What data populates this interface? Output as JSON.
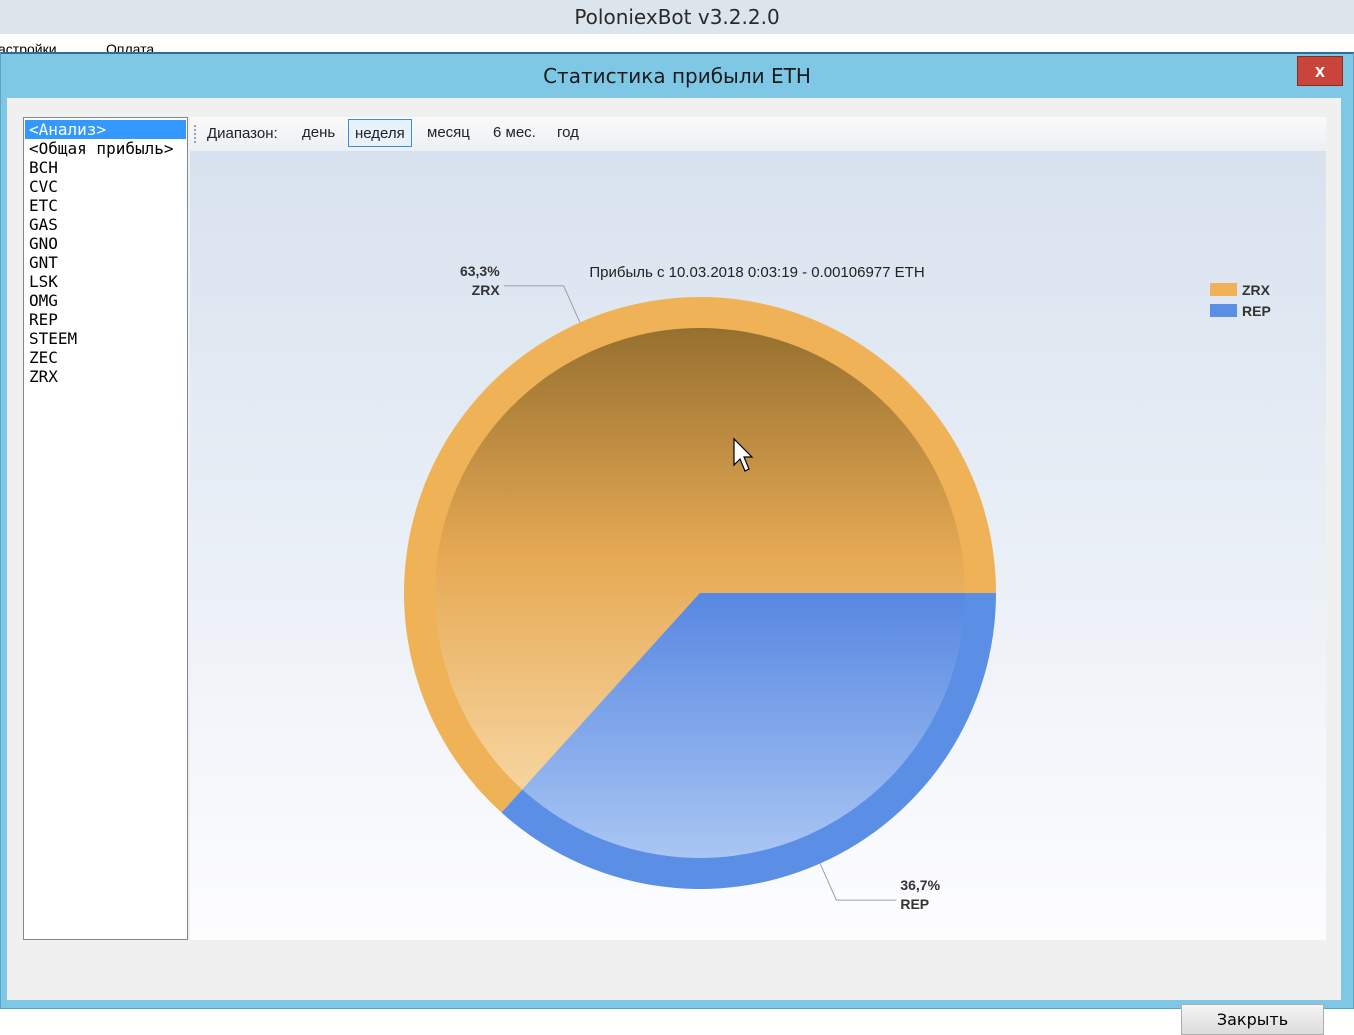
{
  "app": {
    "title": "PoloniexBot v3.2.2.0"
  },
  "main_menu": [
    "астройки",
    "Оплата"
  ],
  "dialog": {
    "title": "Статистика прибыли ETH",
    "close_glyph": "x",
    "close_button": "Закрыть"
  },
  "sidebar": {
    "items": [
      "<Анализ>",
      "<Общая прибыль>",
      "BCH",
      "CVC",
      "ETC",
      "GAS",
      "GNO",
      "GNT",
      "LSK",
      "OMG",
      "REP",
      "STEEM",
      "ZEC",
      "ZRX"
    ],
    "selected_index": 0
  },
  "toolbar": {
    "range_label": "Диапазон:",
    "ranges": [
      "день",
      "неделя",
      "месяц",
      "6 мес.",
      "год"
    ],
    "active_range": "неделя"
  },
  "chart_data": {
    "type": "pie",
    "title": "Прибыль с 10.03.2018 0:03:19 - 0.00106977 ETH",
    "series": [
      {
        "name": "ZRX",
        "value": 63.3,
        "label": "63,3%",
        "color": "#f0b257"
      },
      {
        "name": "REP",
        "value": 36.7,
        "label": "36,7%",
        "color": "#5b8fe6"
      }
    ],
    "legend": {
      "position": "top-right",
      "items": [
        "ZRX",
        "REP"
      ]
    }
  }
}
